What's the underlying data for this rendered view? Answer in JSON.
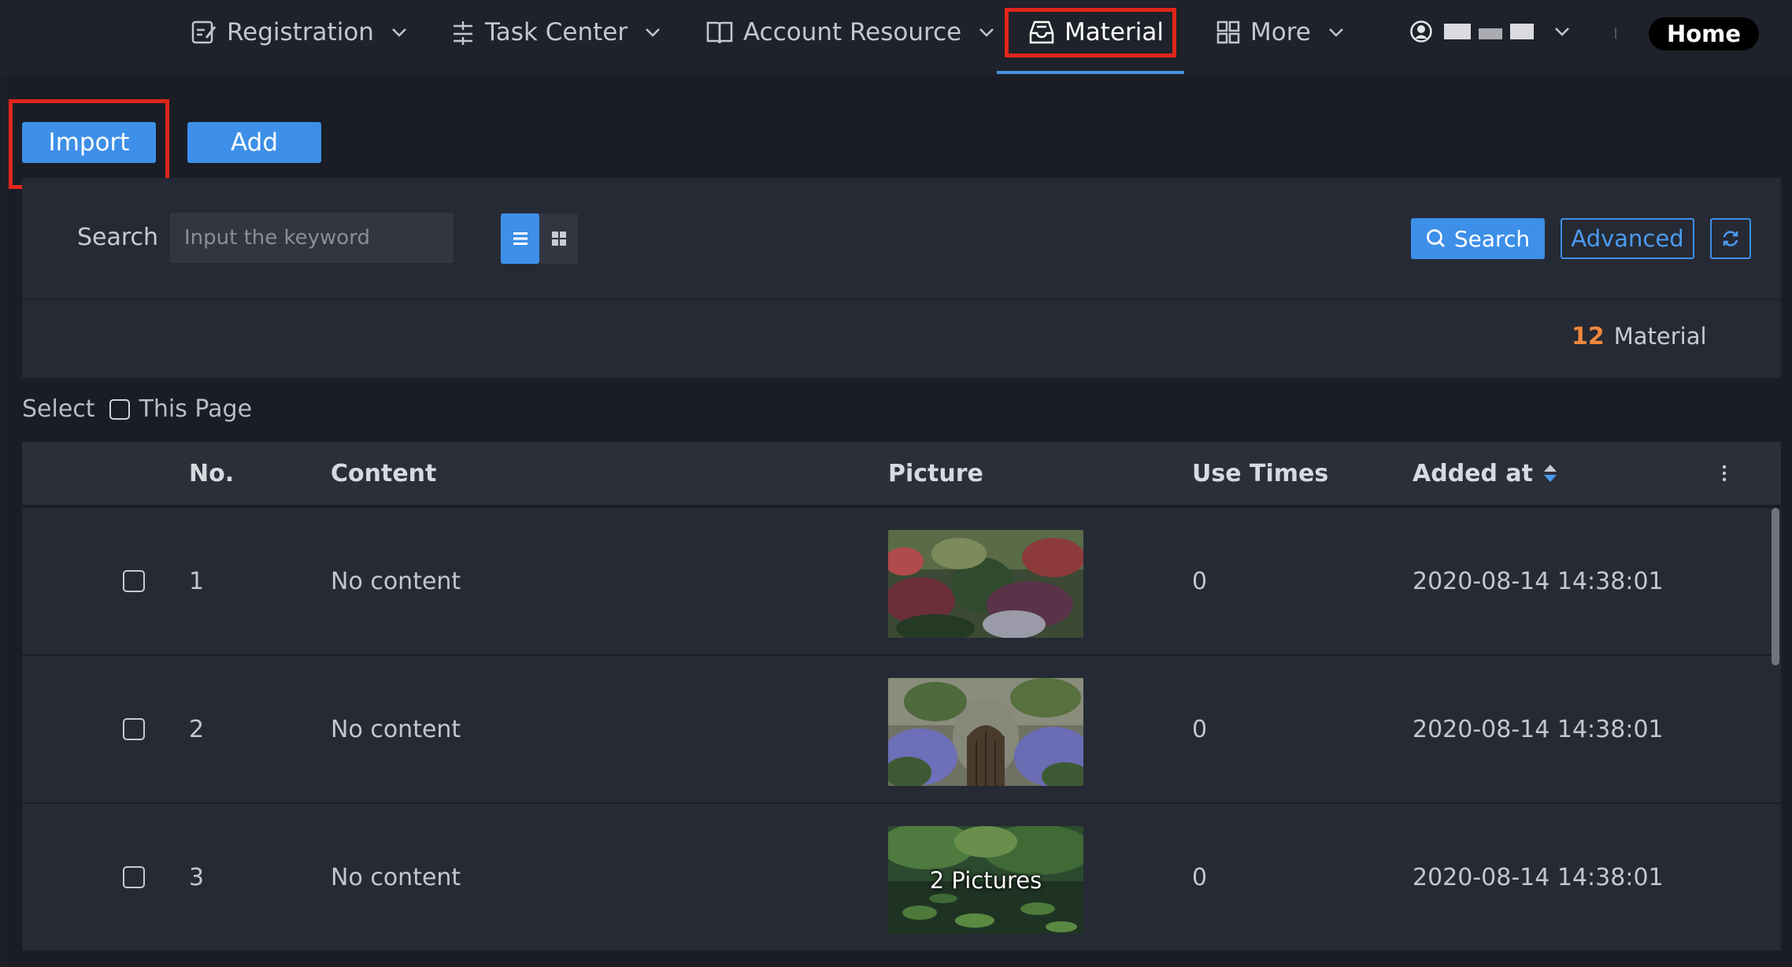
{
  "nav": {
    "items": [
      {
        "label": "Registration",
        "icon": "edit-form-icon"
      },
      {
        "label": "Task Center",
        "icon": "sliders-icon"
      },
      {
        "label": "Account Resource",
        "icon": "book-icon"
      },
      {
        "label": "Material",
        "icon": "inbox-icon",
        "active": true
      },
      {
        "label": "More",
        "icon": "grid-icon"
      }
    ],
    "home": "Home"
  },
  "toolbar": {
    "import": "Import",
    "add": "Add"
  },
  "search": {
    "label": "Search",
    "placeholder": "Input the keyword",
    "search_button": "Search",
    "advanced_button": "Advanced",
    "active_view": "list"
  },
  "summary": {
    "count": "12",
    "unit": "Material"
  },
  "selection": {
    "label": "Select",
    "this_page": "This Page"
  },
  "table": {
    "columns": [
      "No.",
      "Content",
      "Picture",
      "Use Times",
      "Added at"
    ],
    "rows": [
      {
        "no": "1",
        "content": "No content",
        "picture_label": "",
        "use_times": "0",
        "added_at": "2020-08-14 14:38:01"
      },
      {
        "no": "2",
        "content": "No content",
        "picture_label": "",
        "use_times": "0",
        "added_at": "2020-08-14 14:38:01"
      },
      {
        "no": "3",
        "content": "No content",
        "picture_label": "2 Pictures",
        "use_times": "0",
        "added_at": "2020-08-14 14:38:01"
      }
    ]
  },
  "colors": {
    "accent": "#3d8fe8",
    "highlight": "#e0261b",
    "count": "#f0873c"
  }
}
